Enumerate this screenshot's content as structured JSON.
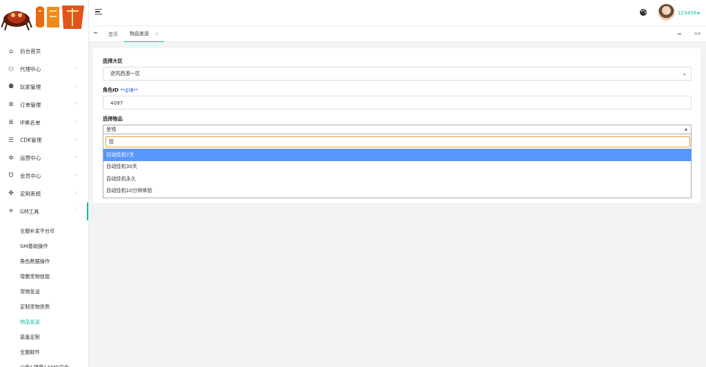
{
  "logo": {
    "text": "封神"
  },
  "sidebar": {
    "items": [
      {
        "label": "后台首页",
        "icon": "home-icon"
      },
      {
        "label": "代理中心",
        "icon": "users-outline-icon",
        "arrow": true
      },
      {
        "label": "玩家管理",
        "icon": "users-icon",
        "arrow": true
      },
      {
        "label": "订单管理",
        "icon": "database-icon",
        "arrow": true
      },
      {
        "label": "IP黑名单",
        "icon": "database-icon",
        "arrow": true
      },
      {
        "label": "CDK管理",
        "icon": "filter-lines-icon",
        "arrow": true
      },
      {
        "label": "运营中心",
        "icon": "gear-icon",
        "arrow": true
      },
      {
        "label": "会员中心",
        "icon": "magnet-icon",
        "arrow": true
      },
      {
        "label": "定制系统",
        "icon": "move-arrows-icon",
        "arrow": true
      },
      {
        "label": "GM工具",
        "icon": "bug-icon",
        "arrow": true,
        "open": true
      }
    ],
    "submenu": [
      {
        "label": "全服补发平台币"
      },
      {
        "label": "GM基础操作"
      },
      {
        "label": "角色数据操作"
      },
      {
        "label": "增删宠物技能"
      },
      {
        "label": "宠物发送"
      },
      {
        "label": "定制宠物资质"
      },
      {
        "label": "物品发送",
        "active": true
      },
      {
        "label": "装备定制"
      },
      {
        "label": "全服邮件"
      },
      {
        "label": "公告&弹幕&CMD命令"
      }
    ]
  },
  "header": {
    "username": "123456",
    "accent_color": "#0fbca0"
  },
  "tabs": {
    "home": "首页",
    "current": "物品发送",
    "close_glyph": "×"
  },
  "form": {
    "region_label": "选择大区",
    "region_value": "逆风西游一区",
    "role_id_label": "角色ID",
    "role_id_required": "**必填**",
    "role_id_value": "4097",
    "item_label": "选择物品",
    "item_value": "金钱",
    "search_value": "挂",
    "options": [
      {
        "label": "自动挂机7天",
        "highlighted": true
      },
      {
        "label": "自动挂机30天"
      },
      {
        "label": "自动挂机永久"
      },
      {
        "label": "自动挂机10分钟体验"
      }
    ],
    "highlight_color": "#5897fb",
    "required_color": "#1e50e6"
  }
}
